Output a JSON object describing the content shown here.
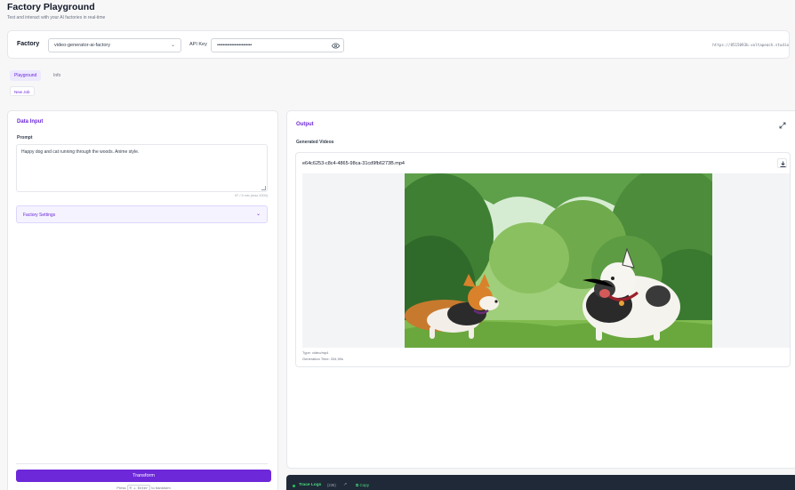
{
  "header": {
    "title": "Factory Playground",
    "subtitle": "Test and interact with your AI factories in real-time"
  },
  "config": {
    "factory_label": "Factory",
    "factory_value": "video-generator-ai-factory",
    "apikey_label": "API Key",
    "apikey_value": "••••••••••••••••••••••••",
    "endpoint_url": "https://8515093b.voltapeach.studio"
  },
  "tabs": [
    {
      "label": "Playground",
      "active": true
    },
    {
      "label": "Info",
      "active": false
    }
  ],
  "new_job_label": "New Job",
  "input_panel": {
    "title": "Data Input",
    "prompt_label": "Prompt",
    "prompt_value": "Happy dog and cat running through the woods. Anime style.",
    "char_count": "57 / 5 min (max 2000)",
    "settings_label": "Factory Settings",
    "transform_label": "Transform",
    "hint_prefix": "Press",
    "hint_key1": "⌘",
    "hint_plus": "+",
    "hint_key2": "Enter",
    "hint_suffix": "to transform"
  },
  "output_panel": {
    "title": "Output",
    "generated_label": "Generated Videos",
    "file_name": "e64c6253-c8c4-4865-98ca-31cd9fb6273B.mp4",
    "type_text": "Type: video/mp4",
    "gen_time_text": "Generation Time: 334,90s"
  },
  "trace": {
    "label": "Trace Logs",
    "count": "(236)",
    "copy_label": "Copy"
  },
  "colors": {
    "accent": "#6d28d9",
    "accent_light": "#ede9fe",
    "trace_bg": "#1f2937",
    "trace_green": "#4ade80"
  }
}
